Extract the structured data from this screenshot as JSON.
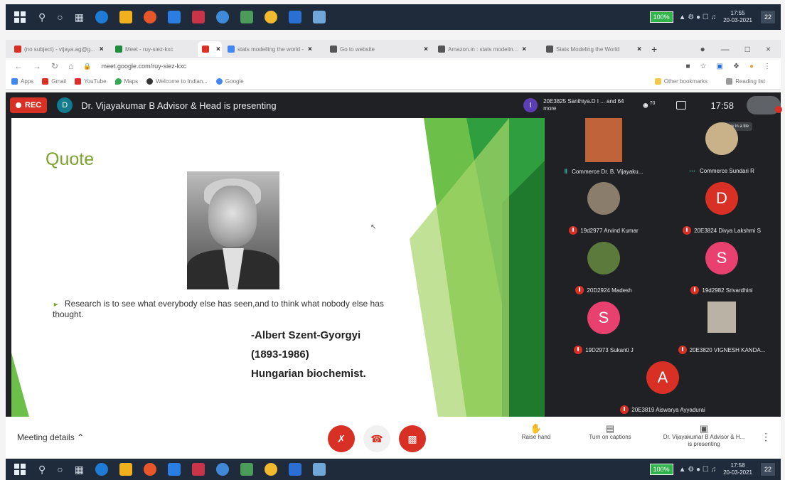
{
  "taskbar": {
    "battery": "100%",
    "time": "17:55",
    "date": "20-03-2021",
    "bottom_time": "17:58",
    "bottom_date": "20-03-2021",
    "notifications": "22"
  },
  "tabs": [
    {
      "label": "(no subject) - vijaya.ag@g...",
      "color": "#d93025"
    },
    {
      "label": "Meet - ruy-siez-kxc",
      "color": "#1e8e3e"
    },
    {
      "label": "",
      "color": "#d93025"
    },
    {
      "label": "stats modelling the world -",
      "color": "#4285f4"
    },
    {
      "label": "Go to website",
      "color": "#555555"
    },
    {
      "label": "Amazon.in : stats modelin...",
      "color": "#555555"
    },
    {
      "label": "Stats Modeling the World",
      "color": "#555555"
    }
  ],
  "address": {
    "url": "meet.google.com/ruy-siez-kxc"
  },
  "bookmarks": [
    "Apps",
    "Gmail",
    "YouTube",
    "Maps",
    "Welcome to Indian...",
    "Google"
  ],
  "bookmarks_right": [
    "Other bookmarks",
    "Reading list"
  ],
  "meet": {
    "rec": "REC",
    "presenter_initial": "D",
    "presenter_text": "Dr. Vijayakumar B Advisor & Head is presenting",
    "joined_initial": "I",
    "joined_text": "20E3825 Santhiya.D I ... and 64 more",
    "people_count": "70",
    "clock": "17:58",
    "tooltip": "Show in a tile"
  },
  "slide": {
    "title": "Quote",
    "bullet": "Research is to see what everybody else has seen,and to think what nobody else has thought.",
    "author": "-Albert Szent-Gyorgyi",
    "years": "(1893-1986)",
    "role": "Hungarian biochemist."
  },
  "participants": [
    {
      "name": "Commerce Dr. B. Vijayaku...",
      "initial": "",
      "color": "#c0623a",
      "status": "speaking"
    },
    {
      "name": "Commerce Sundari R",
      "initial": "",
      "color": "#c9b28a",
      "status": "dots"
    },
    {
      "name": "19d2977 Arvind Kumar",
      "initial": "",
      "color": "#8a7d6c",
      "status": "muted"
    },
    {
      "name": "20E3824 Divya Lakshmi S",
      "initial": "D",
      "color": "#d93025",
      "status": "muted"
    },
    {
      "name": "20D2924 Madesh",
      "initial": "",
      "color": "#5c7a3c",
      "status": "muted"
    },
    {
      "name": "19d2982 Srivardhini",
      "initial": "S",
      "color": "#e8416f",
      "status": "muted"
    },
    {
      "name": "19D2973 Sukanti J",
      "initial": "S",
      "color": "#e8416f",
      "status": "muted"
    },
    {
      "name": "20E3820 VIGNESH KANDA...",
      "initial": "",
      "color": "#b9b2a5",
      "status": "muted"
    },
    {
      "name": "20E3819 Aiswarya Ayyadurai",
      "initial": "A",
      "color": "#d93025",
      "status": "muted"
    }
  ],
  "bottom": {
    "meeting_details": "Meeting details",
    "raise_hand": "Raise hand",
    "captions": "Turn on captions",
    "presenting_line1": "Dr. Vijayakumar B Advisor & H...",
    "presenting_line2": "is presenting"
  }
}
